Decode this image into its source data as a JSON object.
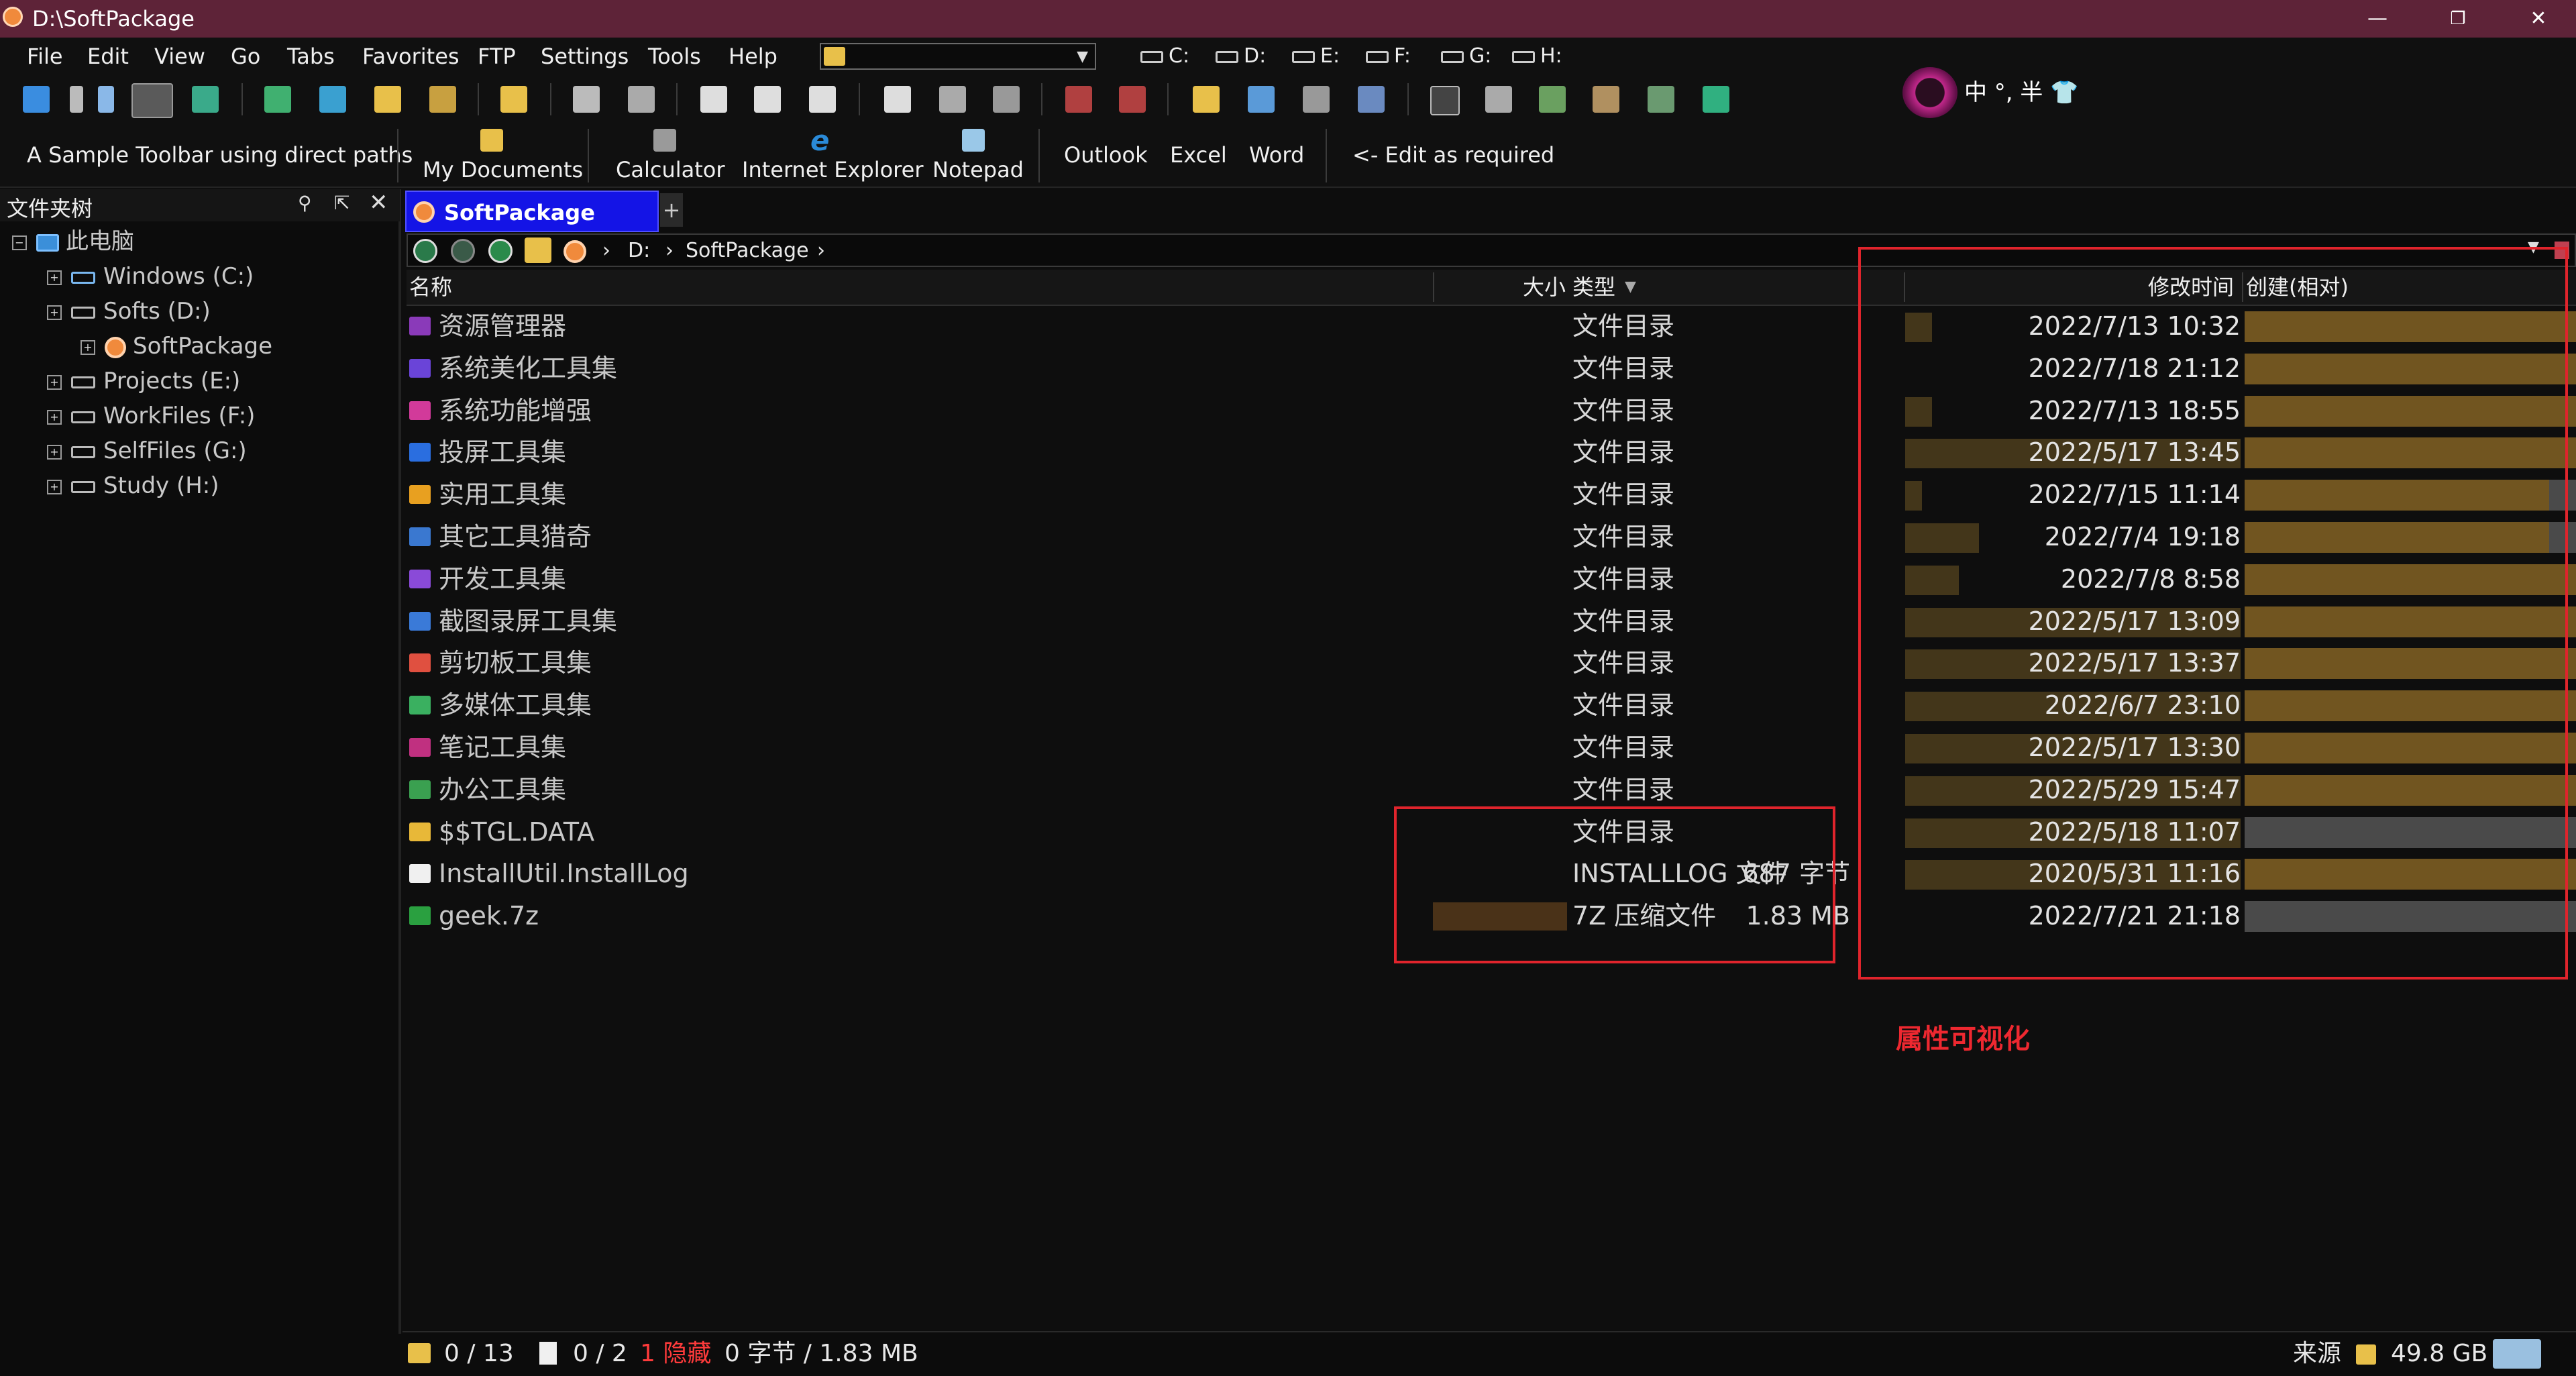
{
  "window": {
    "title": "D:\\SoftPackage",
    "min": "—",
    "max": "❐",
    "close": "✕"
  },
  "menu": [
    "File",
    "Edit",
    "View",
    "Go",
    "Tabs",
    "Favorites",
    "FTP",
    "Settings",
    "Tools",
    "Help"
  ],
  "drives": [
    "C:",
    "D:",
    "E:",
    "F:",
    "G:",
    "H:"
  ],
  "ime": {
    "text": "中 °, 半 👕"
  },
  "sample_toolbar": {
    "caption": "A Sample Toolbar using direct paths",
    "items": [
      "My Documents",
      "Calculator",
      "Internet Explorer",
      "Notepad",
      "Outlook",
      "Excel",
      "Word",
      "<- Edit as required"
    ]
  },
  "tree": {
    "header": "文件夹树",
    "root": "此电脑",
    "items": [
      "Windows (C:)",
      "Softs (D:)",
      "SoftPackage",
      "Projects (E:)",
      "WorkFiles (F:)",
      "SelfFiles (G:)",
      "Study (H:)"
    ]
  },
  "tab": {
    "label": "SoftPackage",
    "plus": "+"
  },
  "address": {
    "crumbs": [
      "D:",
      "SoftPackage"
    ],
    "sep": "›"
  },
  "columns": {
    "name": "名称",
    "size": "大小",
    "type": "类型",
    "modified": "修改时间",
    "created": "创建(相对)"
  },
  "files": [
    {
      "name": "资源管理器",
      "size": "",
      "type": "文件目录",
      "modified": "2022/7/13 10:32",
      "color": "#8a3ab9",
      "datebar": 0.08,
      "rel": 1.0
    },
    {
      "name": "系统美化工具集",
      "size": "",
      "type": "文件目录",
      "modified": "2022/7/18 21:12",
      "color": "#6a44d8",
      "datebar": 0,
      "rel": 1.0
    },
    {
      "name": "系统功能增强",
      "size": "",
      "type": "文件目录",
      "modified": "2022/7/13 18:55",
      "color": "#d23a9a",
      "datebar": 0.08,
      "rel": 1.0
    },
    {
      "name": "投屏工具集",
      "size": "",
      "type": "文件目录",
      "modified": "2022/5/17 13:45",
      "color": "#2a6ee0",
      "datebar": 1.0,
      "rel": 1.0
    },
    {
      "name": "实用工具集",
      "size": "",
      "type": "文件目录",
      "modified": "2022/7/15 11:14",
      "color": "#e8a020",
      "datebar": 0.05,
      "rel": 0.92
    },
    {
      "name": "其它工具猎奇",
      "size": "",
      "type": "文件目录",
      "modified": "2022/7/4 19:18",
      "color": "#3a78d0",
      "datebar": 0.22,
      "rel": 0.92
    },
    {
      "name": "开发工具集",
      "size": "",
      "type": "文件目录",
      "modified": "2022/7/8 8:58",
      "color": "#8a4ad8",
      "datebar": 0.16,
      "rel": 1.0
    },
    {
      "name": "截图录屏工具集",
      "size": "",
      "type": "文件目录",
      "modified": "2022/5/17 13:09",
      "color": "#3a7ad8",
      "datebar": 1.0,
      "rel": 1.0
    },
    {
      "name": "剪切板工具集",
      "size": "",
      "type": "文件目录",
      "modified": "2022/5/17 13:37",
      "color": "#e05040",
      "datebar": 1.0,
      "rel": 1.0
    },
    {
      "name": "多媒体工具集",
      "size": "",
      "type": "文件目录",
      "modified": "2022/6/7 23:10",
      "color": "#3ab060",
      "datebar": 1.0,
      "rel": 1.0
    },
    {
      "name": "笔记工具集",
      "size": "",
      "type": "文件目录",
      "modified": "2022/5/17 13:30",
      "color": "#c03080",
      "datebar": 1.0,
      "rel": 1.0
    },
    {
      "name": "办公工具集",
      "size": "",
      "type": "文件目录",
      "modified": "2022/5/29 15:47",
      "color": "#3aa050",
      "datebar": 1.0,
      "rel": 1.0
    },
    {
      "name": "$$TGL.DATA",
      "size": "",
      "type": "文件目录",
      "modified": "2022/5/18 11:07",
      "color": "#e8b838",
      "datebar": 1.0,
      "rel": 0
    },
    {
      "name": "InstallUtil.InstallLog",
      "size": "687 字节",
      "type": "INSTALLLOG 文件",
      "modified": "2020/5/31 11:16",
      "color": "#f0f0f0",
      "datebar": 1.0,
      "rel": 1.0
    },
    {
      "name": "geek.7z",
      "size": "1.83 MB",
      "type": "7Z 压缩文件",
      "modified": "2022/7/21 21:18",
      "color": "#2aa040",
      "datebar": 0,
      "rel": 0
    }
  ],
  "annotation": "属性可视化",
  "status": {
    "folders": "0 / 13",
    "files": "0 / 2",
    "hidden": "1 隐藏",
    "bytes": "0 字节 / 1.83 MB",
    "source": "来源",
    "free": "49.8 GB"
  }
}
